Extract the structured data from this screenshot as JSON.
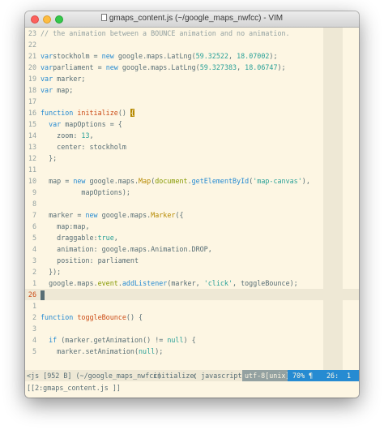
{
  "window": {
    "title": "gmaps_content.js (~/google_maps_nwfcc) - VIM",
    "file_icon": "document-icon"
  },
  "editor": {
    "lines": [
      {
        "n": "23",
        "t": [
          [
            "cm",
            "// the animation between a BOUNCE animation and no animation."
          ]
        ]
      },
      {
        "n": "22",
        "t": []
      },
      {
        "n": "21",
        "t": [
          [
            "kw",
            "var"
          ],
          [
            "",
            "stockholm = "
          ],
          [
            "kw",
            "new"
          ],
          [
            "",
            " google.maps.LatLng("
          ],
          [
            "num",
            "59.32522"
          ],
          [
            "",
            ", "
          ],
          [
            "num",
            "18.07002"
          ],
          [
            "",
            ");"
          ]
        ]
      },
      {
        "n": "20",
        "t": [
          [
            "kw",
            "var"
          ],
          [
            "",
            "parliament = "
          ],
          [
            "kw",
            "new"
          ],
          [
            "",
            " google.maps.LatLng("
          ],
          [
            "num",
            "59.327383"
          ],
          [
            "",
            ", "
          ],
          [
            "num",
            "18.06747"
          ],
          [
            "",
            ");"
          ]
        ]
      },
      {
        "n": "19",
        "t": [
          [
            "kw",
            "var"
          ],
          [
            "",
            " marker;"
          ]
        ]
      },
      {
        "n": "18",
        "t": [
          [
            "kw",
            "var"
          ],
          [
            "",
            " map;"
          ]
        ]
      },
      {
        "n": "17",
        "t": []
      },
      {
        "n": "16",
        "t": [
          [
            "kw",
            "function"
          ],
          [
            "",
            " "
          ],
          [
            "def",
            "initialize"
          ],
          [
            "",
            "() "
          ],
          [
            "bracket",
            "{"
          ]
        ]
      },
      {
        "n": "15",
        "t": [
          [
            "",
            ""
          ],
          [
            "kw",
            "  var"
          ],
          [
            "",
            " mapOptions = {"
          ]
        ]
      },
      {
        "n": "14",
        "t": [
          [
            "",
            "    zoom: "
          ],
          [
            "num",
            "13"
          ],
          [
            "",
            ","
          ]
        ]
      },
      {
        "n": "13",
        "t": [
          [
            "",
            "    center: stockholm"
          ]
        ]
      },
      {
        "n": "12",
        "t": [
          [
            "",
            "  };"
          ]
        ]
      },
      {
        "n": "11",
        "t": []
      },
      {
        "n": "10",
        "t": [
          [
            "",
            "  map = "
          ],
          [
            "kw",
            "new"
          ],
          [
            "",
            " google.maps."
          ],
          [
            "ctor",
            "Map"
          ],
          [
            "",
            "("
          ],
          [
            "obj",
            "document"
          ],
          [
            "",
            "."
          ],
          [
            "fn",
            "getElementById"
          ],
          [
            "",
            "("
          ],
          [
            "str",
            "'map-canvas'"
          ],
          [
            "",
            "),"
          ]
        ]
      },
      {
        "n": "9",
        "t": [
          [
            "",
            "          mapOptions);"
          ]
        ]
      },
      {
        "n": "8",
        "t": []
      },
      {
        "n": "7",
        "t": [
          [
            "",
            "  marker = "
          ],
          [
            "kw",
            "new"
          ],
          [
            "",
            " google.maps."
          ],
          [
            "ctor",
            "Marker"
          ],
          [
            "",
            "({"
          ]
        ]
      },
      {
        "n": "6",
        "t": [
          [
            "",
            "    map:map,"
          ]
        ]
      },
      {
        "n": "5",
        "t": [
          [
            "",
            "    draggable:"
          ],
          [
            "num",
            "true"
          ],
          [
            "",
            ","
          ]
        ]
      },
      {
        "n": "4",
        "t": [
          [
            "",
            "    animation: google.maps.Animation.DROP,"
          ]
        ]
      },
      {
        "n": "3",
        "t": [
          [
            "",
            "    position: parliament"
          ]
        ]
      },
      {
        "n": "2",
        "t": [
          [
            "",
            "  });"
          ]
        ]
      },
      {
        "n": "1",
        "t": [
          [
            "",
            "  google.maps."
          ],
          [
            "obj",
            "event"
          ],
          [
            "",
            "."
          ],
          [
            "fn",
            "addListener"
          ],
          [
            "",
            "(marker, "
          ],
          [
            "str",
            "'click'"
          ],
          [
            "",
            ", toggleBounce);"
          ]
        ]
      },
      {
        "n": "26",
        "cur": true,
        "t": [
          [
            "cursor",
            "}"
          ]
        ]
      },
      {
        "n": "1",
        "t": []
      },
      {
        "n": "2",
        "t": [
          [
            "kw",
            "function"
          ],
          [
            "",
            " "
          ],
          [
            "def",
            "toggleBounce"
          ],
          [
            "",
            "() {"
          ]
        ]
      },
      {
        "n": "3",
        "t": []
      },
      {
        "n": "4",
        "t": [
          [
            "",
            "  "
          ],
          [
            "kw",
            "if"
          ],
          [
            "",
            " (marker.getAnimation() != "
          ],
          [
            "num",
            "null"
          ],
          [
            "",
            ") {"
          ]
        ]
      },
      {
        "n": "5",
        "t": [
          [
            "",
            "    marker.setAnimation("
          ],
          [
            "num",
            "null"
          ],
          [
            "",
            ");"
          ]
        ]
      }
    ]
  },
  "statusline": {
    "file": "<js [952 B] (~/google_maps_nwfcc)",
    "function": "initialize",
    "separator": "❮",
    "filetype": "javascript",
    "encoding": "utf-8[unix]",
    "percent": "70%",
    "line_icon": "¶",
    "line": "26:",
    "col": "1"
  },
  "cmdline": {
    "text": "[[2:gmaps_content.js ]]"
  }
}
